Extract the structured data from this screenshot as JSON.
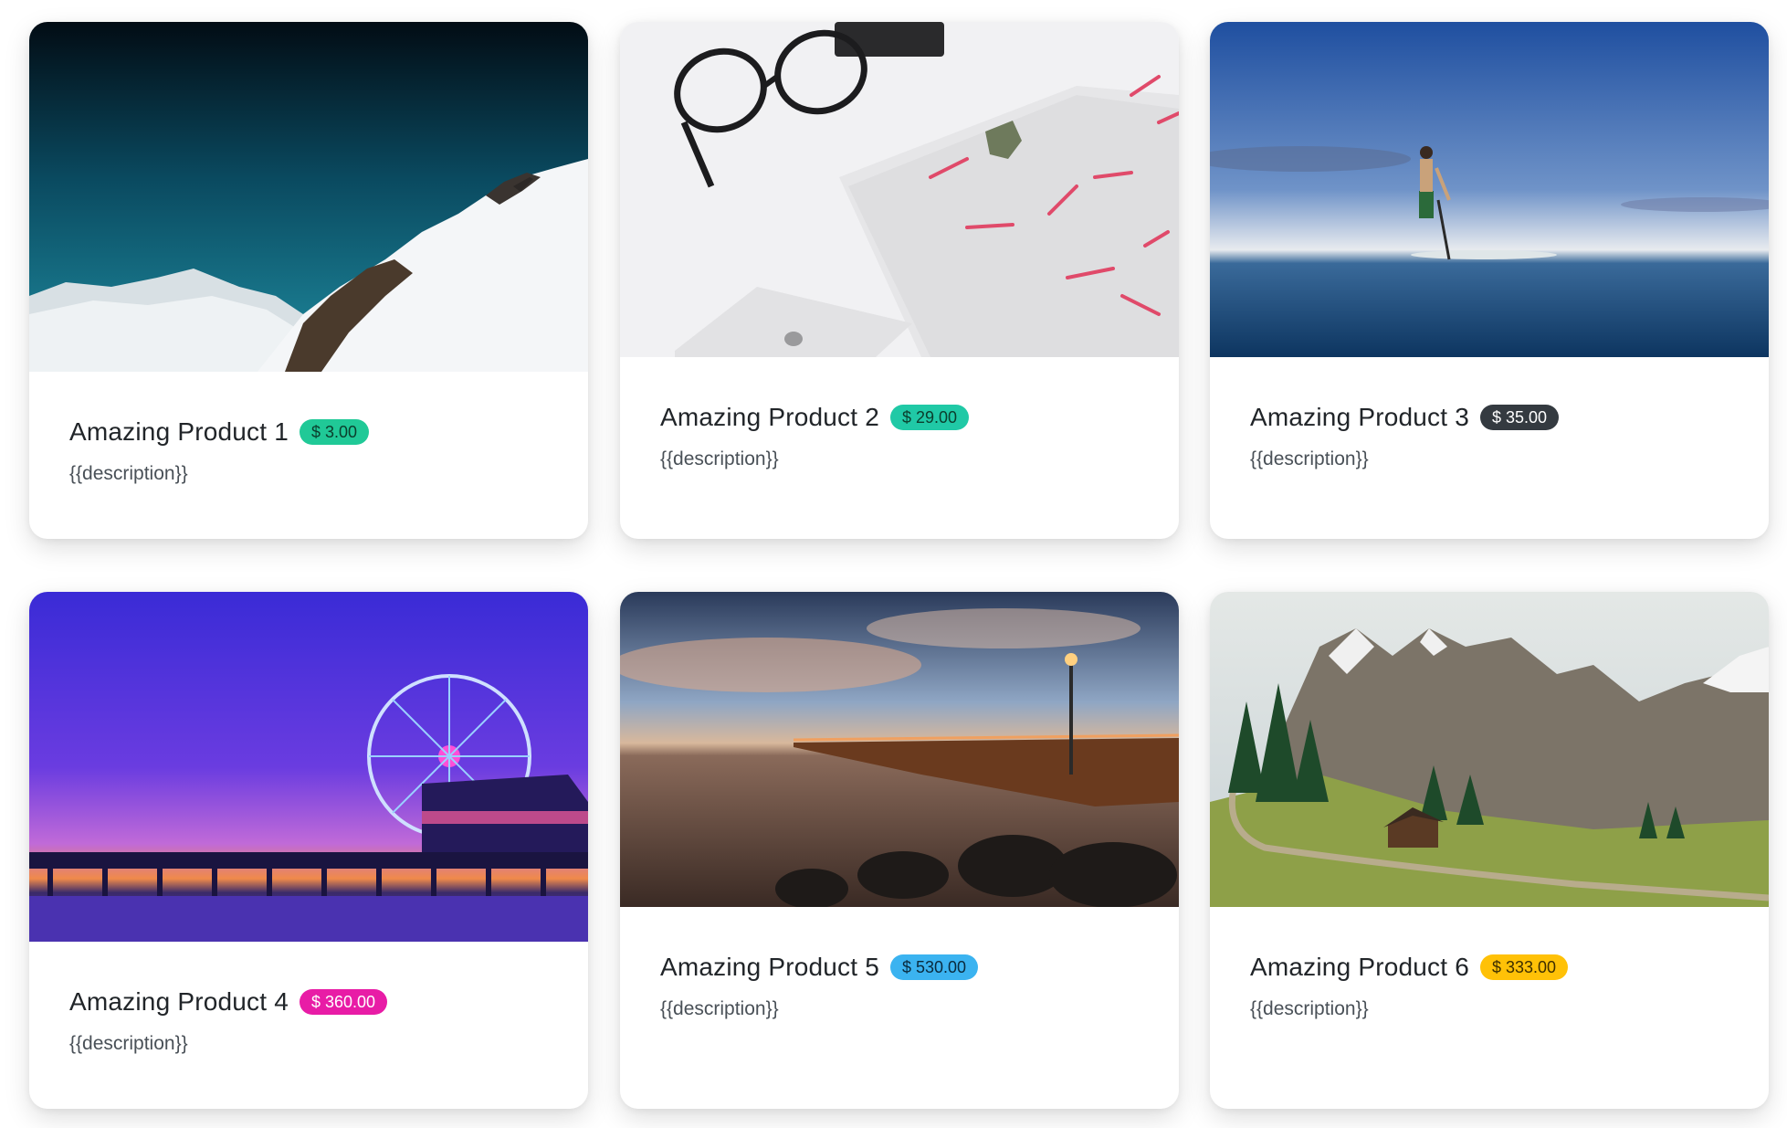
{
  "products": [
    {
      "title": "Amazing Product 1",
      "price": "$ 3.00",
      "description": "{{description}}",
      "badge_bg": "#20c997",
      "badge_fg": "#0b3d2c",
      "image": "snowy-mountain-peak"
    },
    {
      "title": "Amazing Product 2",
      "price": "$ 29.00",
      "description": "{{description}}",
      "badge_bg": "#20c9a6",
      "badge_fg": "#0b3d2c",
      "image": "glasses-laptop-desk"
    },
    {
      "title": "Amazing Product 3",
      "price": "$ 35.00",
      "description": "{{description}}",
      "badge_bg": "#343a40",
      "badge_fg": "#ffffff",
      "image": "paddleboarder-sea"
    },
    {
      "title": "Amazing Product 4",
      "price": "$ 360.00",
      "description": "{{description}}",
      "badge_bg": "#e81ca6",
      "badge_fg": "#ffffff",
      "image": "pier-ferris-wheel-night"
    },
    {
      "title": "Amazing Product 5",
      "price": "$ 530.00",
      "description": "{{description}}",
      "badge_bg": "#3bb3f0",
      "badge_fg": "#0a2a3d",
      "image": "wooden-pier-sunset"
    },
    {
      "title": "Amazing Product 6",
      "price": "$ 333.00",
      "description": "{{description}}",
      "badge_bg": "#ffc107",
      "badge_fg": "#3d2e00",
      "image": "alpine-valley-cabin"
    }
  ]
}
